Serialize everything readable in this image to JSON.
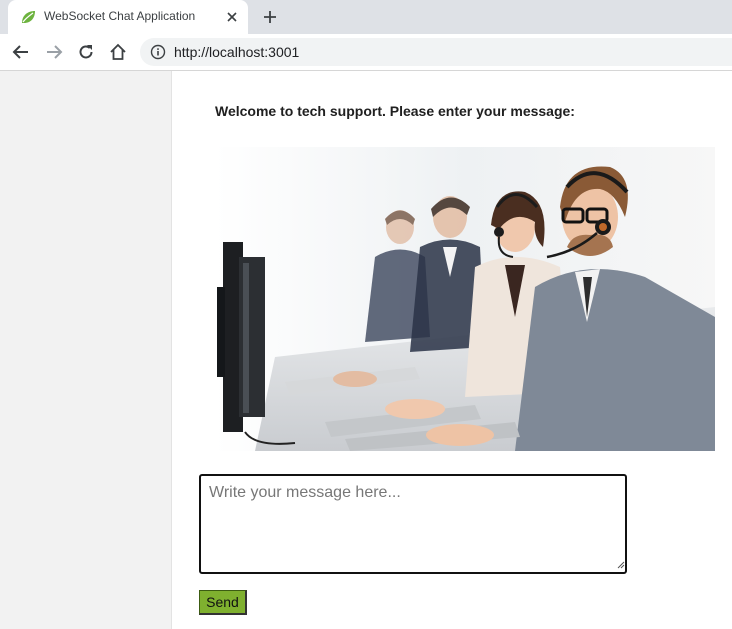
{
  "browser": {
    "tab": {
      "title": "WebSocket Chat Application",
      "favicon": "spring-leaf-icon",
      "close_icon": "close-icon"
    },
    "new_tab_icon": "plus-icon",
    "nav": {
      "back_icon": "back-arrow-icon",
      "forward_icon": "forward-arrow-icon",
      "reload_icon": "reload-icon",
      "home_icon": "home-icon"
    },
    "address_bar": {
      "info_icon": "info-icon",
      "url": "http://localhost:3001"
    }
  },
  "page": {
    "welcome_text": "Welcome to tech support. Please enter your message:",
    "hero_image": "call-center-agents-photo",
    "message_input": {
      "placeholder": "Write your message here...",
      "value": ""
    },
    "send_label": "Send"
  },
  "colors": {
    "send_button": "#7fb02f",
    "tab_bar": "#dee1e6",
    "page_background": "#f2f2f2"
  }
}
